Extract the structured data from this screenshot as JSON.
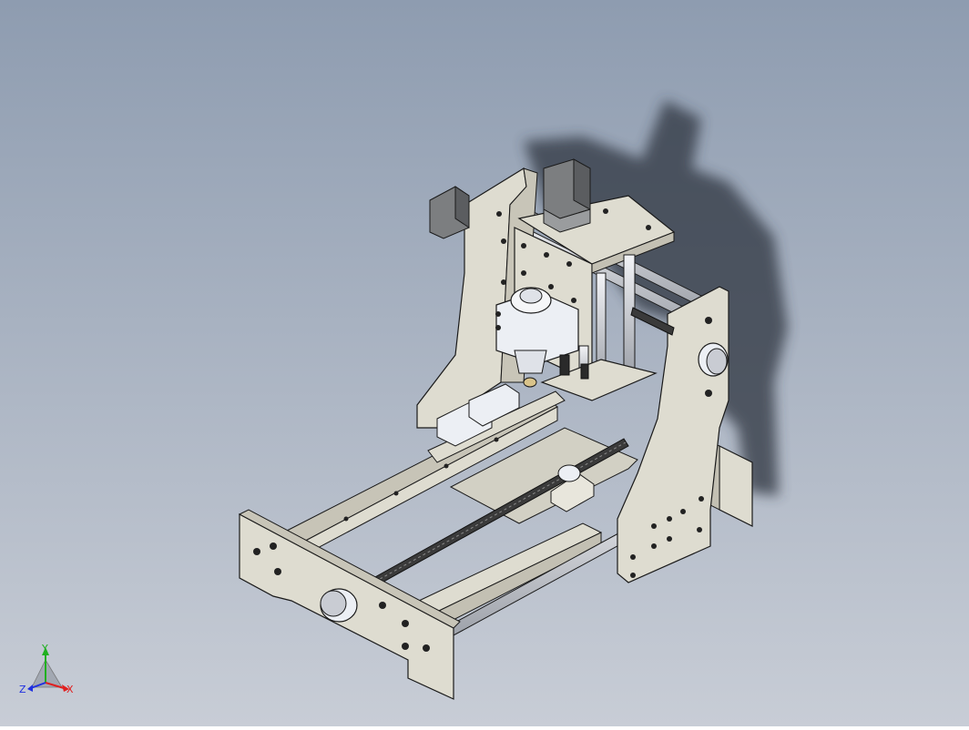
{
  "viewport": {
    "background_top": "#8e9cb0",
    "background_bottom": "#c8cdd6"
  },
  "model": {
    "frame_color": "#dedcd0",
    "edge_color": "#1a1a1a",
    "shadow_color": "#2f3440",
    "rod_color": "#c9ccd3",
    "screw_color": "#3a3a3a",
    "motor_color": "#7c7e80",
    "spindle_color": "#eceff4"
  },
  "triad": {
    "x_label": "X",
    "y_label": "Y",
    "z_label": "Z",
    "x_color": "#e02020",
    "y_color": "#20b020",
    "z_color": "#2030e0"
  }
}
